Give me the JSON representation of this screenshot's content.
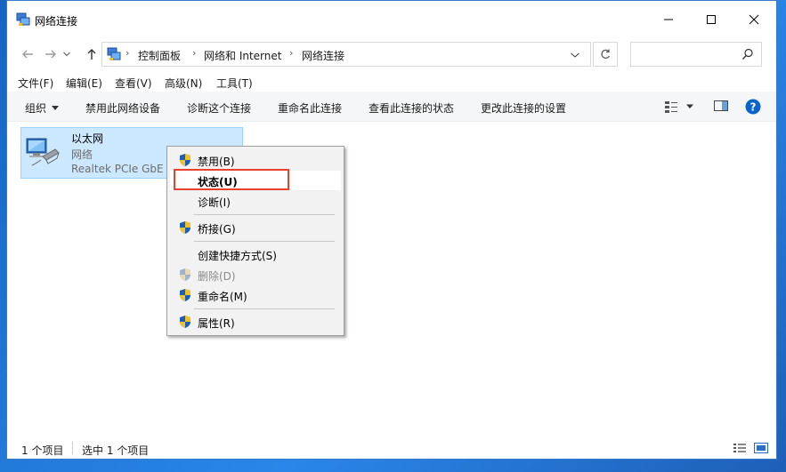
{
  "window": {
    "title": "网络连接"
  },
  "nav": {
    "breadcrumbs": [
      "控制面板",
      "网络和 Internet",
      "网络连接"
    ],
    "search_placeholder": ""
  },
  "menubar": {
    "items": [
      "文件(F)",
      "编辑(E)",
      "查看(V)",
      "高级(N)",
      "工具(T)"
    ]
  },
  "commandbar": {
    "organize": "组织",
    "items": [
      "禁用此网络设备",
      "诊断这个连接",
      "重命名此连接",
      "查看此连接的状态",
      "更改此连接的设置"
    ]
  },
  "connection": {
    "name": "以太网",
    "type": "网络",
    "device": "Realtek PCIe GbE F"
  },
  "context_menu": {
    "items": [
      {
        "label": "禁用(B)",
        "shield": true,
        "disabled": false
      },
      {
        "label": "状态(U)",
        "shield": false,
        "disabled": false
      },
      {
        "label": "诊断(I)",
        "shield": false,
        "disabled": false
      },
      {
        "label": "桥接(G)",
        "shield": true,
        "disabled": false
      },
      {
        "label": "创建快捷方式(S)",
        "shield": false,
        "disabled": false
      },
      {
        "label": "删除(D)",
        "shield": true,
        "disabled": true
      },
      {
        "label": "重命名(M)",
        "shield": true,
        "disabled": false
      },
      {
        "label": "属性(R)",
        "shield": true,
        "disabled": false
      }
    ]
  },
  "statusbar": {
    "count": "1 个项目",
    "selected": "选中 1 个项目"
  },
  "colors": {
    "accent": "#0078d7",
    "selection": "#cce8ff",
    "highlight_border": "#e8412c"
  }
}
